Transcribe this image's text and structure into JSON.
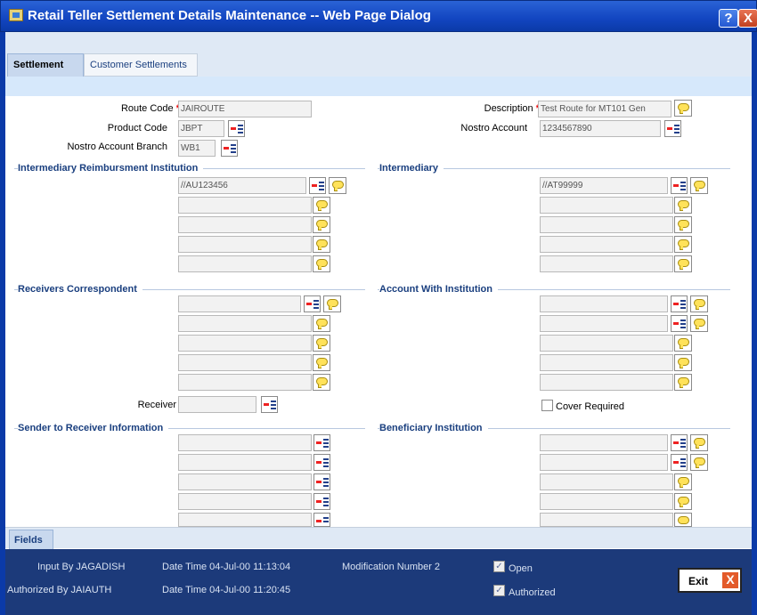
{
  "window": {
    "title": "Retail Teller Settlement Details Maintenance -- Web Page Dialog",
    "help_label": "?",
    "close_label": "X"
  },
  "tabs": [
    {
      "label": "Settlement"
    },
    {
      "label": "Customer Settlements"
    }
  ],
  "form": {
    "route_code_label": "Route Code",
    "route_code_value": "JAIROUTE",
    "description_label": "Description",
    "description_value": "Test Route for MT101 Gen",
    "product_code_label": "Product Code",
    "product_code_value": "JBPT",
    "nostro_account_label": "Nostro Account",
    "nostro_account_value": "1234567890",
    "nostro_branch_label": "Nostro Account Branch",
    "nostro_branch_value": "WB1",
    "required_mark": "*"
  },
  "sections": {
    "irf": {
      "title": "Intermediary Reimbursment Institution",
      "first_value": "//AU123456"
    },
    "intermediary": {
      "title": "Intermediary",
      "first_value": "//AT99999"
    },
    "receivers_correspondent": {
      "title": "Receivers Correspondent"
    },
    "account_with": {
      "title": "Account With Institution"
    },
    "receiver_label": "Receiver",
    "cover_required_label": "Cover Required",
    "sender_to_receiver": {
      "title": "Sender to Receiver Information"
    },
    "beneficiary": {
      "title": "Beneficiary Institution"
    }
  },
  "footer": {
    "fields_tab": "Fields",
    "input_by": "Input By JAGADISH",
    "input_date": "Date Time 04-Jul-00 11:13:04",
    "modification": "Modification Number 2",
    "authorized_by": "Authorized By JAIAUTH",
    "auth_date": "Date Time 04-Jul-00 11:20:45",
    "open_label": "Open",
    "authorized_label": "Authorized",
    "exit_label": "Exit",
    "exit_icon": "X"
  },
  "colors": {
    "title_bar": "#1245c0",
    "section_title": "#1a3f7f",
    "audit_bg": "#1c3a7a"
  }
}
